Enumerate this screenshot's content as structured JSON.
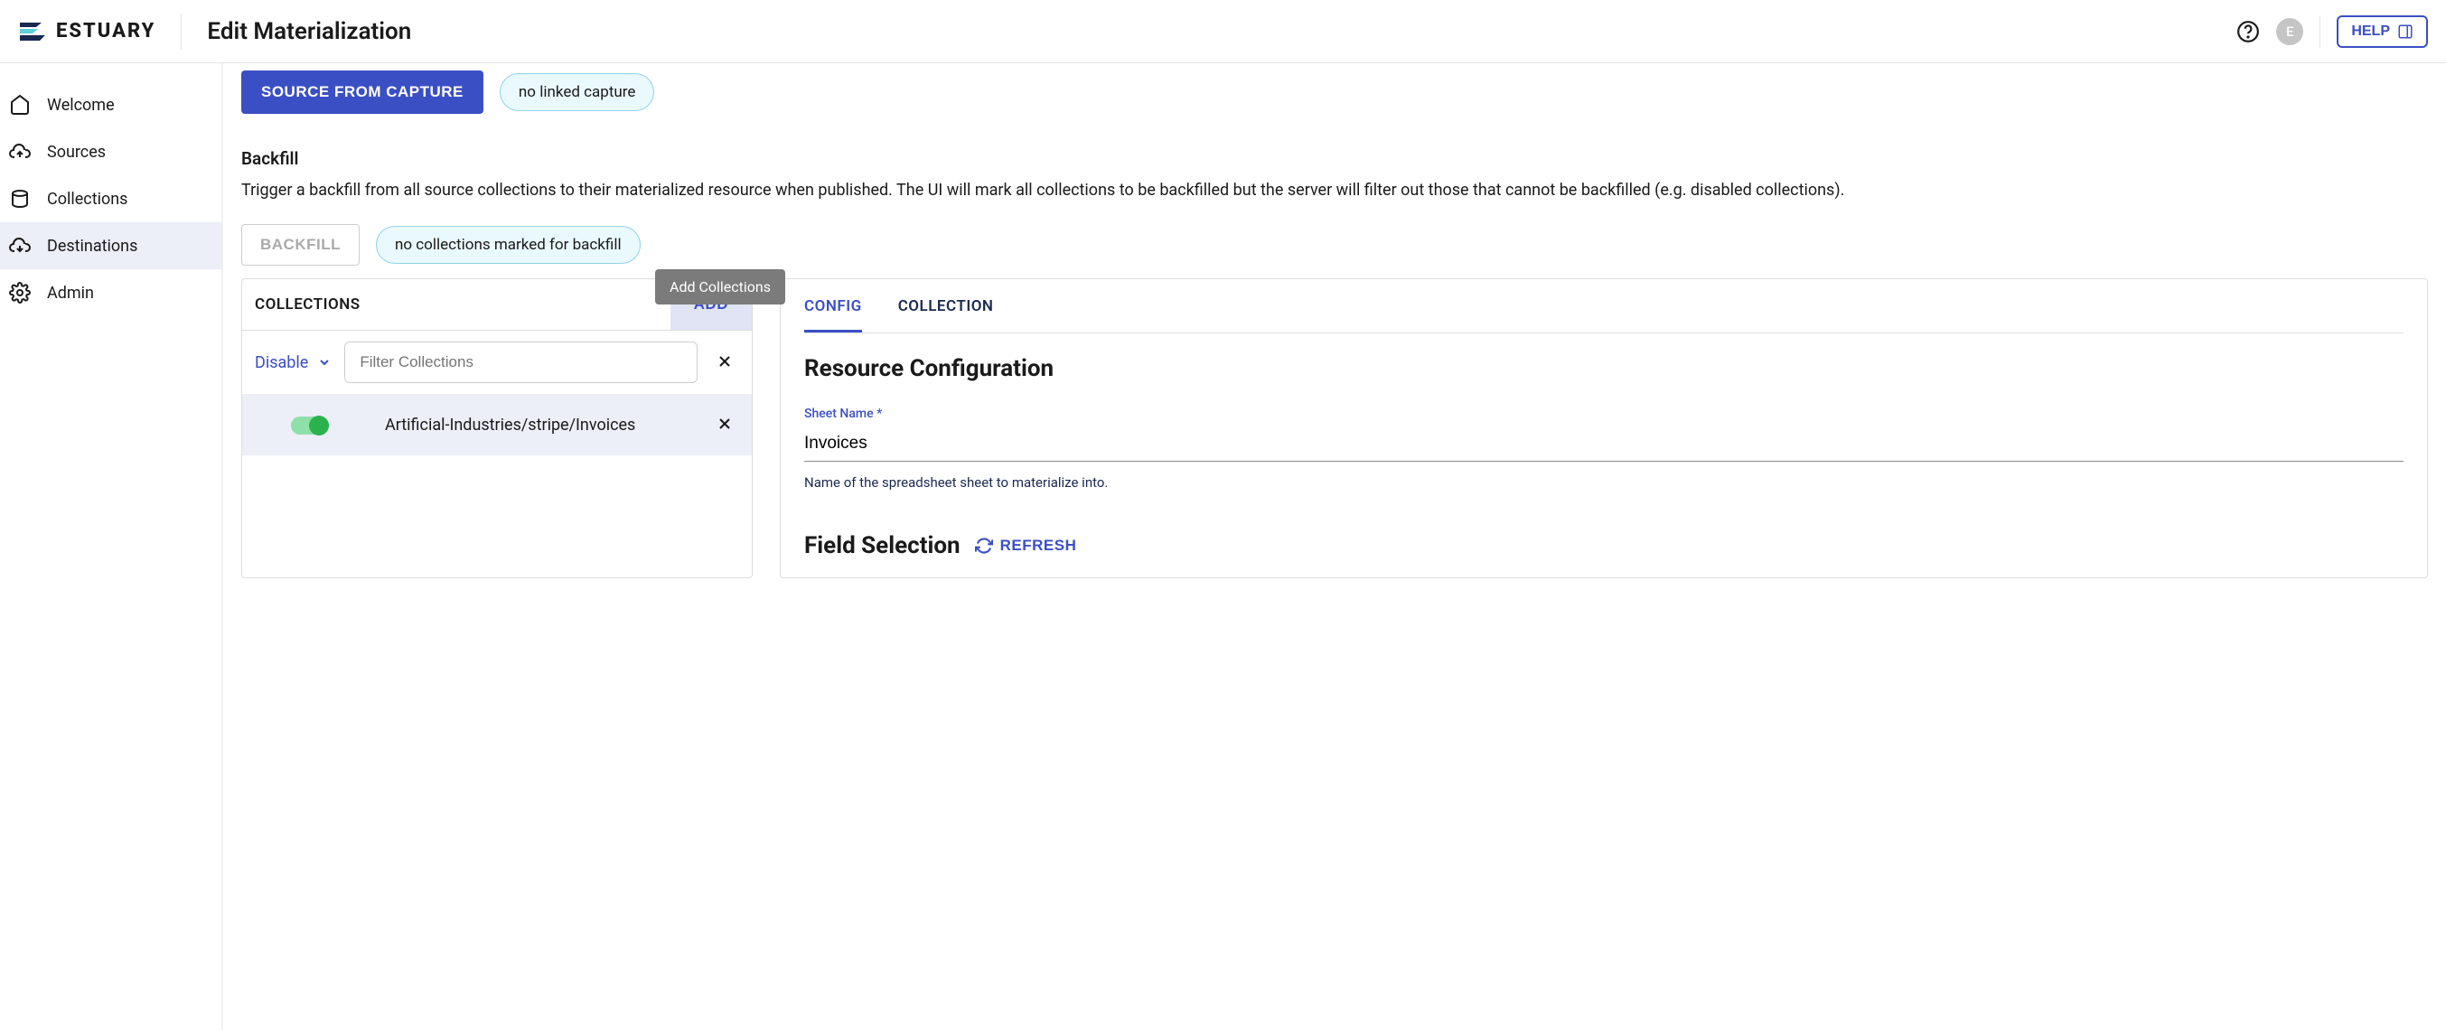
{
  "brand": "ESTUARY",
  "page_title": "Edit Materialization",
  "avatar_initial": "E",
  "help_label": "HELP",
  "sidebar": {
    "items": [
      {
        "label": "Welcome"
      },
      {
        "label": "Sources"
      },
      {
        "label": "Collections"
      },
      {
        "label": "Destinations"
      },
      {
        "label": "Admin"
      }
    ]
  },
  "source_capture": {
    "button": "SOURCE FROM CAPTURE",
    "status": "no linked capture"
  },
  "backfill": {
    "heading": "Backfill",
    "description": "Trigger a backfill from all source collections to their materialized resource when published. The UI will mark all collections to be backfilled but the server will filter out those that cannot be backfilled (e.g. disabled collections).",
    "button": "BACKFILL",
    "status": "no collections marked for backfill"
  },
  "tooltip": "Add Collections",
  "collections_panel": {
    "header": "COLLECTIONS",
    "add_label": "ADD",
    "disable_label": "Disable",
    "filter_placeholder": "Filter Collections",
    "rows": [
      {
        "name": "Artificial-Industries/stripe/Invoices",
        "enabled": true
      }
    ]
  },
  "config_panel": {
    "tabs": {
      "config": "CONFIG",
      "collection": "COLLECTION"
    },
    "heading": "Resource Configuration",
    "sheet_name": {
      "label": "Sheet Name",
      "required": "*",
      "value": "Invoices",
      "help": "Name of the spreadsheet sheet to materialize into."
    },
    "field_selection": {
      "heading": "Field Selection",
      "refresh": "REFRESH"
    }
  }
}
